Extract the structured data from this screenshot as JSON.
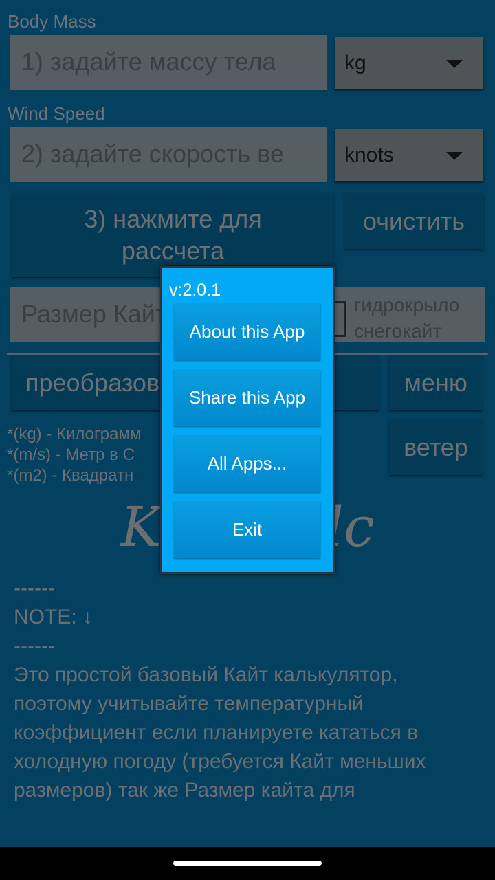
{
  "body_mass": {
    "label": "Body Mass",
    "placeholder": "1) задайте массу тела",
    "unit": "kg"
  },
  "wind_speed": {
    "label": "Wind Speed",
    "placeholder": "2) задайте скорость ве",
    "unit": "knots"
  },
  "calc_button": "3) нажмите для рассчета",
  "clear_button": "очистить",
  "kite_size_placeholder": "Размер Кайта",
  "options": [
    "гидрокрыло",
    "снегокайт"
  ],
  "convert_button": "преобразовать ... ин",
  "menu_button": "меню",
  "wind_button": "ветер",
  "legend": [
    "*(kg) - Килограмм",
    "*(m/s) - Метр в С",
    "*(m2) - Квадратн"
  ],
  "logo": "Kite Calc",
  "note": {
    "dash1": "------",
    "title": "NOTE: ↓",
    "dash2": "------",
    "text": "Это простой базовый Кайт калькулятор, поэтому учитывайте температурный коэффициент если планируете кататься в холодную погоду (требуется Кайт меньших размеров) так же Размер кайта для"
  },
  "dialog": {
    "version": "v:2.0.1",
    "buttons": [
      "About this App",
      "Share this App",
      "All Apps...",
      "Exit"
    ]
  }
}
